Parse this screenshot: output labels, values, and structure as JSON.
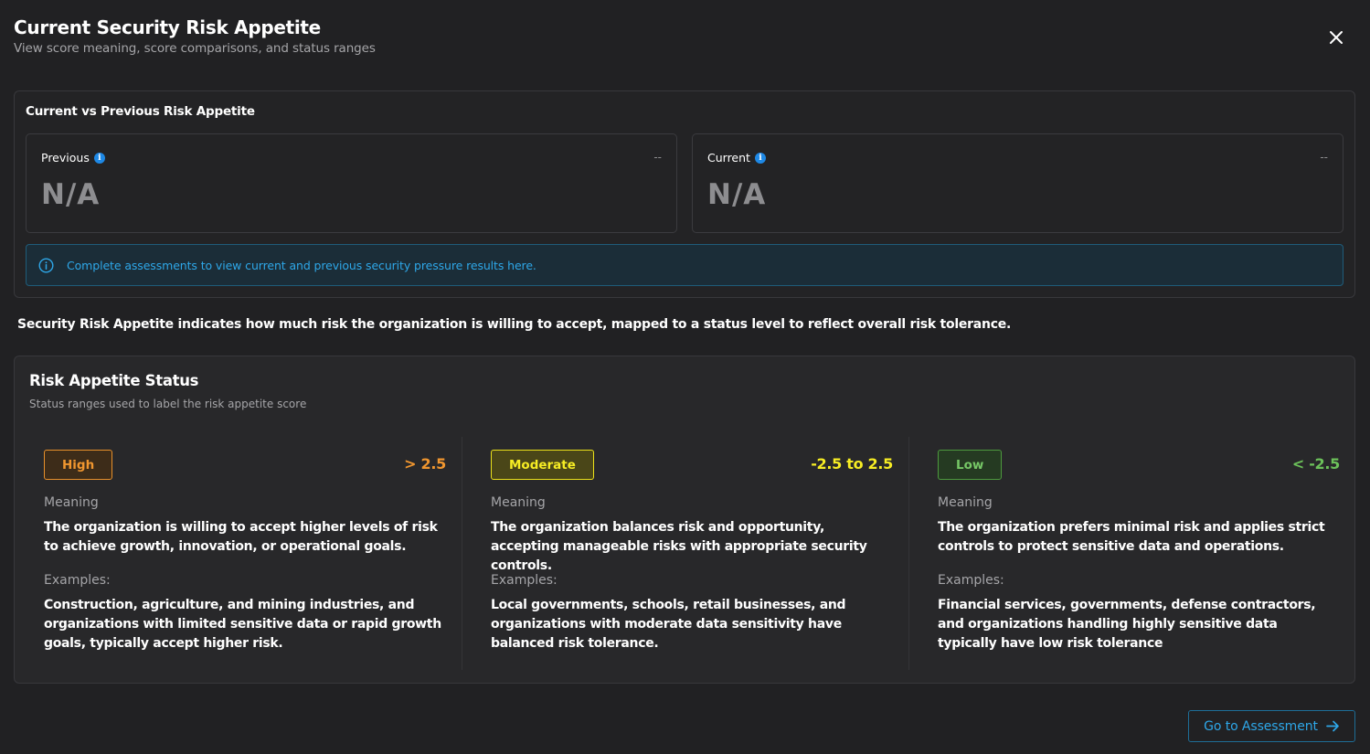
{
  "header": {
    "title": "Current Security Risk Appetite",
    "subtitle": "View score meaning, score comparisons, and status ranges",
    "close_icon": "close-icon"
  },
  "comparison": {
    "title": "Current vs Previous Risk Appetite",
    "previous": {
      "label": "Previous",
      "value": "N/A",
      "delta": "--",
      "icon": "info-icon"
    },
    "current": {
      "label": "Current",
      "value": "N/A",
      "delta": "--",
      "icon": "info-icon"
    },
    "banner_text": "Complete assessments to view current and previous security pressure results here."
  },
  "description": "Security Risk Appetite indicates how much risk the organization is willing to accept, mapped to a status level to reflect overall risk tolerance.",
  "status": {
    "title": "Risk Appetite Status",
    "subtitle": "Status ranges used to label the risk appetite score",
    "levels": [
      {
        "badge": "High",
        "range": "> 2.5",
        "meaning_label": "Meaning",
        "meaning": "The organization is willing to accept higher levels of risk to achieve growth, innovation, or operational goals.",
        "examples_label": "Examples:",
        "examples": "Construction, agriculture, and mining industries, and organizations with limited sensitive data or rapid growth goals, typically accept higher risk.",
        "color": "#f0962f"
      },
      {
        "badge": "Moderate",
        "range": "-2.5 to 2.5",
        "meaning_label": "Meaning",
        "meaning": "The organization balances risk and opportunity, accepting manageable risks with appropriate security controls.",
        "examples_label": "Examples:",
        "examples": "Local governments, schools, retail businesses, and organizations with moderate data sensitivity have balanced risk tolerance.",
        "color": "#f7ed24"
      },
      {
        "badge": "Low",
        "range": "< -2.5",
        "meaning_label": "Meaning",
        "meaning": "The organization prefers minimal risk and applies strict controls to protect sensitive data and operations.",
        "examples_label": "Examples:",
        "examples": "Financial services, governments, defense contractors, and organizations handling highly sensitive data typically have low risk tolerance",
        "color": "#6cc15a"
      }
    ]
  },
  "footer": {
    "button_label": "Go to Assessment",
    "button_icon": "arrow-right-icon",
    "accent": "#2ea7e8"
  }
}
